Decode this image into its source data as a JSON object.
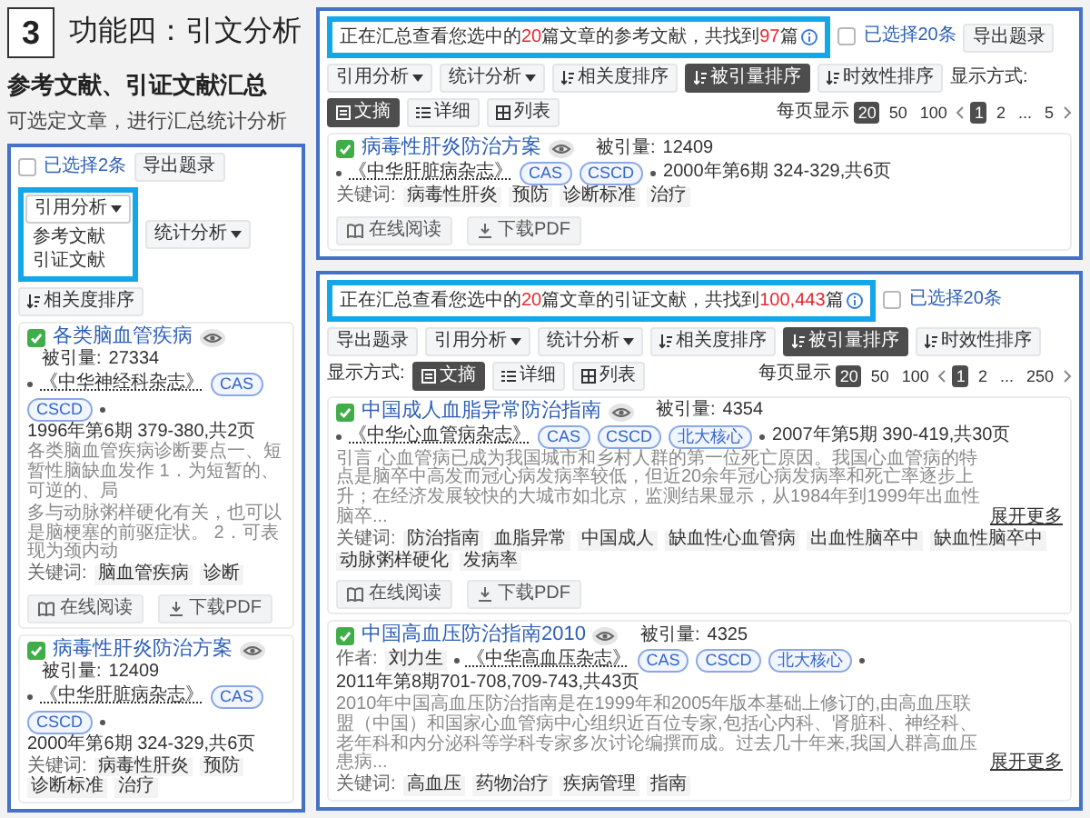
{
  "slide": {
    "number": "3",
    "title": "功能四：引文分析",
    "subtitle": "参考文献、引证文献汇总",
    "description": "可选定文章，进行汇总统计分析"
  },
  "left_panel": {
    "toolbar": {
      "select_all": {
        "label": "已选择2条",
        "checked": false
      },
      "actions": [
        {
          "kind": "button",
          "label": "导出题录"
        },
        {
          "kind": "dropdown",
          "label": "引用分析",
          "expanded": true,
          "highlighted": true,
          "options": [
            "参考文献",
            "引证文献"
          ]
        },
        {
          "kind": "dropdown",
          "label": "统计分析",
          "expanded": false
        }
      ],
      "sorts": [
        {
          "label": "相关度排序",
          "selected": false
        }
      ]
    },
    "articles": [
      {
        "checked": true,
        "title": "各类脑血管疾病",
        "citations_label": "被引量:",
        "citations": "27334",
        "journal": "《中华神经科杂志》",
        "indexes": [
          "CAS",
          "CSCD"
        ],
        "issue": "1996年第6期 379-380,共2页",
        "abstract_lines": [
          "各类脑血管疾病诊断要点一、短暂性脑缺血发作 1．为短暂的、可逆的、局",
          "多与动脉粥样硬化有关，也可以是脑梗塞的前驱症状。 2．可表现为颈内动"
        ],
        "keywords_label": "关键词:",
        "keywords": [
          "脑血管疾病",
          "诊断"
        ],
        "actions": [
          {
            "kind": "read",
            "label": "在线阅读"
          },
          {
            "kind": "download",
            "label": "下载PDF"
          }
        ]
      },
      {
        "checked": true,
        "title": "病毒性肝炎防治方案",
        "citations_label": "被引量:",
        "citations": "12409",
        "journal": "《中华肝脏病杂志》",
        "indexes": [
          "CAS",
          "CSCD"
        ],
        "issue": "2000年第6期 324-329,共6页",
        "keywords_label": "关键词:",
        "keywords": [
          "病毒性肝炎",
          "预防",
          "诊断标准",
          "治疗"
        ]
      }
    ]
  },
  "panels": [
    {
      "banner": {
        "highlighted": true,
        "parts": [
          {
            "text": "正在汇总查看您选中的",
            "emphasis": false
          },
          {
            "text": "20",
            "emphasis": true
          },
          {
            "text": "篇文章的参考文献，共找到",
            "emphasis": false
          },
          {
            "text": "97",
            "emphasis": true
          },
          {
            "text": "篇",
            "emphasis": false
          }
        ]
      },
      "toolbar": {
        "select_all": {
          "label": "已选择20条",
          "checked": false
        },
        "actions": [
          {
            "kind": "button",
            "label": "导出题录"
          },
          {
            "kind": "dropdown",
            "label": "引用分析",
            "expanded": false
          },
          {
            "kind": "dropdown",
            "label": "统计分析",
            "expanded": false
          }
        ],
        "sorts": [
          {
            "label": "相关度排序",
            "selected": false
          },
          {
            "label": "被引量排序",
            "selected": true
          },
          {
            "label": "时效性排序",
            "selected": false
          }
        ],
        "view_label": "显示方式:",
        "views": [
          {
            "kind": "abstract",
            "label": "文摘",
            "selected": true
          },
          {
            "kind": "detail",
            "label": "详细",
            "selected": false
          },
          {
            "kind": "list",
            "label": "列表",
            "selected": false
          }
        ]
      },
      "pager": {
        "label": "每页显示",
        "sizes": [
          {
            "label": "20",
            "selected": true
          },
          {
            "label": "50",
            "selected": false
          },
          {
            "label": "100",
            "selected": false
          }
        ],
        "pages": [
          {
            "kind": "page",
            "label": "1",
            "selected": true
          },
          {
            "kind": "page",
            "label": "2",
            "selected": false
          },
          {
            "kind": "gap",
            "label": "..."
          },
          {
            "kind": "page",
            "label": "5",
            "selected": false
          }
        ]
      },
      "articles": [
        {
          "checked": true,
          "title": "病毒性肝炎防治方案",
          "citations_label": "被引量:",
          "citations": "12409",
          "journal": "《中华肝脏病杂志》",
          "indexes": [
            "CAS",
            "CSCD"
          ],
          "issue": "2000年第6期 324-329,共6页",
          "keywords_label": "关键词:",
          "keywords": [
            "病毒性肝炎",
            "预防",
            "诊断标准",
            "治疗"
          ],
          "actions": [
            {
              "kind": "read",
              "label": "在线阅读"
            },
            {
              "kind": "download",
              "label": "下载PDF"
            }
          ]
        }
      ]
    },
    {
      "banner": {
        "highlighted": true,
        "parts": [
          {
            "text": "正在汇总查看您选中的",
            "emphasis": false
          },
          {
            "text": "20",
            "emphasis": true
          },
          {
            "text": "篇文章的引证文献，共找到",
            "emphasis": false
          },
          {
            "text": "100,443",
            "emphasis": true
          },
          {
            "text": "篇",
            "emphasis": false
          }
        ]
      },
      "toolbar": {
        "select_all": {
          "label": "已选择20条",
          "checked": false
        },
        "actions": [
          {
            "kind": "button",
            "label": "导出题录"
          },
          {
            "kind": "dropdown",
            "label": "引用分析",
            "expanded": false
          },
          {
            "kind": "dropdown",
            "label": "统计分析",
            "expanded": false
          }
        ],
        "sorts": [
          {
            "label": "相关度排序",
            "selected": false
          },
          {
            "label": "被引量排序",
            "selected": true
          },
          {
            "label": "时效性排序",
            "selected": false
          }
        ],
        "view_label": "显示方式:",
        "views": [
          {
            "kind": "abstract",
            "label": "文摘",
            "selected": true
          },
          {
            "kind": "detail",
            "label": "详细",
            "selected": false
          },
          {
            "kind": "list",
            "label": "列表",
            "selected": false
          }
        ]
      },
      "pager": {
        "label": "每页显示",
        "sizes": [
          {
            "label": "20",
            "selected": true
          },
          {
            "label": "50",
            "selected": false
          },
          {
            "label": "100",
            "selected": false
          }
        ],
        "pages": [
          {
            "kind": "page",
            "label": "1",
            "selected": true
          },
          {
            "kind": "page",
            "label": "2",
            "selected": false
          },
          {
            "kind": "gap",
            "label": "..."
          },
          {
            "kind": "page",
            "label": "250",
            "selected": false
          }
        ]
      },
      "articles": [
        {
          "checked": true,
          "title": "中国成人血脂异常防治指南",
          "citations_label": "被引量:",
          "citations": "4354",
          "journal": "《中华心血管病杂志》",
          "indexes": [
            "CAS",
            "CSCD",
            "北大核心"
          ],
          "issue": "2007年第5期 390-419,共30页",
          "abstract": "引言 心血管病已成为我国城市和乡村人群的第一位死亡原因。我国心血管病的特点是脑卒中高发而冠心病发病率较低，但近20余年冠心病发病率和死亡率逐步上升；在经济发展较快的大城市如北京，监测结果显示，从1984年到1999年出血性脑卒...",
          "expand_link": "展开更多",
          "keywords_label": "关键词:",
          "keywords": [
            "防治指南",
            "血脂异常",
            "中国成人",
            "缺血性心血管病",
            "出血性脑卒中",
            "缺血性脑卒中",
            "动脉粥样硬化",
            "发病率"
          ],
          "actions": [
            {
              "kind": "read",
              "label": "在线阅读"
            },
            {
              "kind": "download",
              "label": "下载PDF"
            }
          ]
        },
        {
          "checked": true,
          "title": "中国高血压防治指南2010",
          "citations_label": "被引量:",
          "citations": "4325",
          "author_label": "作者:",
          "author": "刘力生",
          "journal": "《中华高血压杂志》",
          "indexes": [
            "CAS",
            "CSCD",
            "北大核心"
          ],
          "issue": "2011年第8期701-708,709-743,共43页",
          "abstract": "2010年中国高血压防治指南是在1999年和2005年版本基础上修订的,由高血压联盟（中国）和国家心血管病中心组织近百位专家,包括心内科、肾脏科、神经科、老年科和内分泌科等学科专家多次讨论编撰而成。过去几十年来,我国人群高血压患病...",
          "expand_link": "展开更多",
          "keywords_label": "关键词:",
          "keywords": [
            "高血压",
            "药物治疗",
            "疾病管理",
            "指南"
          ]
        }
      ]
    }
  ]
}
